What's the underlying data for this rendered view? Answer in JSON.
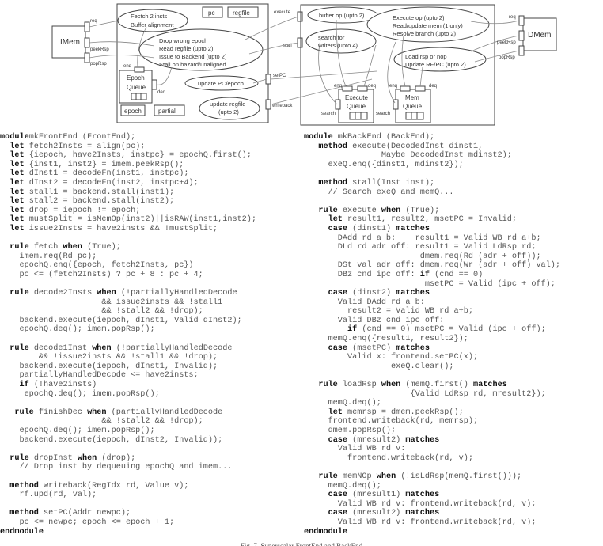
{
  "diagram": {
    "imem": {
      "label": "IMem",
      "ports": [
        "req",
        "peekRsp",
        "popRsp"
      ]
    },
    "dmem": {
      "label": "DMem",
      "ports": [
        "req",
        "peekRsp",
        "popRsp"
      ]
    },
    "frontend": {
      "state": [
        "pc",
        "regfile",
        "epoch",
        "partial"
      ],
      "clouds": {
        "fetch": [
          "Fectch 2 insts",
          "Buffer alignment"
        ],
        "decode": [
          "Drop wrong epoch",
          "Read regfile (upto 2)",
          "Issue to Backend  (upto 2)",
          "Stall on hazard/unaligned"
        ],
        "update_pc": [
          "update PC/epoch"
        ],
        "update_rf": [
          "update regfile",
          "(upto 2)"
        ]
      },
      "epoch_queue": {
        "label": [
          "Epoch",
          "Queue"
        ],
        "ports": [
          "enq",
          "deq"
        ]
      }
    },
    "interface_ports": [
      "execute",
      "stall",
      "setPC",
      "writeback"
    ],
    "backend": {
      "clouds": {
        "buffer": [
          "buffer op (upto 2)"
        ],
        "search": [
          "search for",
          "writers (upto 4)"
        ],
        "exec": [
          "Execute op (upto 2)",
          "Read/update mem (1 only)",
          "Resolve branch (upto 2)"
        ],
        "load": [
          "Load rsp or nop",
          "Update RF/PC (upto 2)"
        ]
      },
      "execute_queue": {
        "label": [
          "Execute",
          "Queue"
        ],
        "ports": [
          "enq",
          "deq",
          "search"
        ]
      },
      "mem_queue": {
        "label": [
          "Mem",
          "Queue"
        ],
        "ports": [
          "enq",
          "deq",
          "search"
        ]
      }
    }
  },
  "code_left": [
    [
      [
        "kw",
        "module"
      ],
      [
        "",
        "mkFrontEnd (FrontEnd);"
      ]
    ],
    [
      [
        "",
        "  "
      ],
      [
        "kw",
        "let"
      ],
      [
        "",
        " fetch2Insts = align(pc);"
      ]
    ],
    [
      [
        "",
        "  "
      ],
      [
        "kw",
        "let"
      ],
      [
        "",
        " {iepoch, have2Insts, instpc} = epochQ.first();"
      ]
    ],
    [
      [
        "",
        "  "
      ],
      [
        "kw",
        "let"
      ],
      [
        "",
        " {inst1, inst2} = imem.peekRsp();"
      ]
    ],
    [
      [
        "",
        "  "
      ],
      [
        "kw",
        "let"
      ],
      [
        "",
        " dInst1 = decodeFn(inst1, instpc);"
      ]
    ],
    [
      [
        "",
        "  "
      ],
      [
        "kw",
        "let"
      ],
      [
        "",
        " dInst2 = decodeFn(inst2, instpc+4);"
      ]
    ],
    [
      [
        "",
        "  "
      ],
      [
        "kw",
        "let"
      ],
      [
        "",
        " stall1 = backend.stall(inst1);"
      ]
    ],
    [
      [
        "",
        "  "
      ],
      [
        "kw",
        "let"
      ],
      [
        "",
        " stall2 = backend.stall(inst2);"
      ]
    ],
    [
      [
        "",
        "  "
      ],
      [
        "kw",
        "let"
      ],
      [
        "",
        " drop = iepoch != epoch;"
      ]
    ],
    [
      [
        "",
        "  "
      ],
      [
        "kw",
        "let"
      ],
      [
        "",
        " mustSplit = isMemOp(inst2)||isRAW(inst1,inst2);"
      ]
    ],
    [
      [
        "",
        "  "
      ],
      [
        "kw",
        "let"
      ],
      [
        "",
        " issue2Insts = have2insts && !mustSplit;"
      ]
    ],
    [
      [
        "",
        ""
      ]
    ],
    [
      [
        "",
        "  "
      ],
      [
        "kw",
        "rule"
      ],
      [
        "",
        " fetch "
      ],
      [
        "kw",
        "when"
      ],
      [
        "",
        " (True);"
      ]
    ],
    [
      [
        "",
        "    imem.req(Rd pc);"
      ]
    ],
    [
      [
        "",
        "    epochQ.enq({epoch, fetch2Insts, pc})"
      ]
    ],
    [
      [
        "",
        "    pc <= (fetch2Insts) ? pc + 8 : pc + 4;"
      ]
    ],
    [
      [
        "",
        ""
      ]
    ],
    [
      [
        "",
        "  "
      ],
      [
        "kw",
        "rule"
      ],
      [
        "",
        " decode2Insts "
      ],
      [
        "kw",
        "when"
      ],
      [
        "",
        " (!partiallyHandledDecode"
      ]
    ],
    [
      [
        "",
        "                     && issue2insts && !stall1"
      ]
    ],
    [
      [
        "",
        "                     && !stall2 && !drop);"
      ]
    ],
    [
      [
        "",
        "    backend.execute(iepoch, dInst1, Valid dInst2);"
      ]
    ],
    [
      [
        "",
        "    epochQ.deq(); imem.popRsp();"
      ]
    ],
    [
      [
        "",
        ""
      ]
    ],
    [
      [
        "",
        "  "
      ],
      [
        "kw",
        "rule"
      ],
      [
        "",
        " decode1Inst "
      ],
      [
        "kw",
        "when"
      ],
      [
        "",
        " (!partiallyHandledDecode"
      ]
    ],
    [
      [
        "",
        "        && !issue2insts && !stall1 && !drop);"
      ]
    ],
    [
      [
        "",
        "    backend.execute(iepoch, dInst1, Invalid);"
      ]
    ],
    [
      [
        "",
        "    partiallyHandledDecode <= have2insts;"
      ]
    ],
    [
      [
        "",
        "    "
      ],
      [
        "kw",
        "if"
      ],
      [
        "",
        " (!have2insts)"
      ]
    ],
    [
      [
        "",
        "     epochQ.deq(); imem.popRsp();"
      ]
    ],
    [
      [
        "",
        ""
      ]
    ],
    [
      [
        "",
        "   "
      ],
      [
        "kw",
        "rule"
      ],
      [
        "",
        " finishDec "
      ],
      [
        "kw",
        "when"
      ],
      [
        "",
        " (partiallyHandledDecode"
      ]
    ],
    [
      [
        "",
        "                     && !stall2 && !drop);"
      ]
    ],
    [
      [
        "",
        "    epochQ.deq(); imem.popRsp();"
      ]
    ],
    [
      [
        "",
        "    backend.execute(iepoch, dInst2, Invalid));"
      ]
    ],
    [
      [
        "",
        ""
      ]
    ],
    [
      [
        "",
        "  "
      ],
      [
        "kw",
        "rule"
      ],
      [
        "",
        " dropInst "
      ],
      [
        "kw",
        "when"
      ],
      [
        "",
        " (drop);"
      ]
    ],
    [
      [
        "",
        "    // Drop inst by dequeuing epochQ and imem..."
      ]
    ],
    [
      [
        "",
        ""
      ]
    ],
    [
      [
        "",
        "  "
      ],
      [
        "kw",
        "method"
      ],
      [
        "",
        " writeback(RegIdx rd, Value v);"
      ]
    ],
    [
      [
        "",
        "    rf.upd(rd, val);"
      ]
    ],
    [
      [
        "",
        ""
      ]
    ],
    [
      [
        "",
        "  "
      ],
      [
        "kw",
        "method"
      ],
      [
        "",
        " setPC(Addr newpc);"
      ]
    ],
    [
      [
        "",
        "    pc <= newpc; epoch <= epoch + 1;"
      ]
    ],
    [
      [
        "kw",
        "endmodule"
      ]
    ]
  ],
  "code_right": [
    [
      [
        "kw",
        "module"
      ],
      [
        "",
        " mkBackEnd (BackEnd);"
      ]
    ],
    [
      [
        "",
        "   "
      ],
      [
        "kw",
        "method"
      ],
      [
        "",
        " execute(DecodedInst dinst1,"
      ]
    ],
    [
      [
        "",
        "                Maybe DecodedInst mdinst2);"
      ]
    ],
    [
      [
        "",
        "     exeQ.enq({dinst1, mdinst2});"
      ]
    ],
    [
      [
        "",
        ""
      ]
    ],
    [
      [
        "",
        "   "
      ],
      [
        "kw",
        "method"
      ],
      [
        "",
        " stall(Inst inst);"
      ]
    ],
    [
      [
        "",
        "     // Search exeQ and memQ..."
      ]
    ],
    [
      [
        "",
        ""
      ]
    ],
    [
      [
        "",
        "   "
      ],
      [
        "kw",
        "rule"
      ],
      [
        "",
        " execute "
      ],
      [
        "kw",
        "when"
      ],
      [
        "",
        " (True);"
      ]
    ],
    [
      [
        "",
        "     "
      ],
      [
        "kw",
        "let"
      ],
      [
        "",
        " result1, result2, msetPC = Invalid;"
      ]
    ],
    [
      [
        "",
        "     "
      ],
      [
        "kw",
        "case"
      ],
      [
        "",
        " (dinst1) "
      ],
      [
        "kw",
        "matches"
      ]
    ],
    [
      [
        "",
        "       DAdd rd a b:    result1 = Valid WB rd a+b;"
      ]
    ],
    [
      [
        "",
        "       DLd rd adr off: result1 = Valid LdRsp rd;"
      ]
    ],
    [
      [
        "",
        "                        dmem.req(Rd (adr + off));"
      ]
    ],
    [
      [
        "",
        "       DSt val adr off: dmem.req(Wr (adr + off) val);"
      ]
    ],
    [
      [
        "",
        "       DBz cnd ipc off: "
      ],
      [
        "kw",
        "if"
      ],
      [
        "",
        " (cnd == 0)"
      ]
    ],
    [
      [
        "",
        "                         msetPC = Valid (ipc + off);"
      ]
    ],
    [
      [
        "",
        "     "
      ],
      [
        "kw",
        "case"
      ],
      [
        "",
        " (dinst2) "
      ],
      [
        "kw",
        "matches"
      ]
    ],
    [
      [
        "",
        "       Valid DAdd rd a b:"
      ]
    ],
    [
      [
        "",
        "         result2 = Valid WB rd a+b;"
      ]
    ],
    [
      [
        "",
        "       Valid DBz cnd ipc off:"
      ]
    ],
    [
      [
        "",
        "         "
      ],
      [
        "kw",
        "if"
      ],
      [
        "",
        " (cnd == 0) msetPC = Valid (ipc + off);"
      ]
    ],
    [
      [
        "",
        "     memQ.enq({result1, result2});"
      ]
    ],
    [
      [
        "",
        "     "
      ],
      [
        "kw",
        "case"
      ],
      [
        "",
        " (msetPC) "
      ],
      [
        "kw",
        "matches"
      ]
    ],
    [
      [
        "",
        "         Valid x: frontend.setPC(x);"
      ]
    ],
    [
      [
        "",
        "                  exeQ.clear();"
      ]
    ],
    [
      [
        "",
        ""
      ]
    ],
    [
      [
        "",
        "   "
      ],
      [
        "kw",
        "rule"
      ],
      [
        "",
        " loadRsp "
      ],
      [
        "kw",
        "when"
      ],
      [
        "",
        " (memQ.first() "
      ],
      [
        "kw",
        "matches"
      ]
    ],
    [
      [
        "",
        "                      {Valid LdRsp rd, mresult2});"
      ]
    ],
    [
      [
        "",
        "     memQ.deq();"
      ]
    ],
    [
      [
        "",
        "     "
      ],
      [
        "kw",
        "let"
      ],
      [
        "",
        " memrsp = dmem.peekRsp();"
      ]
    ],
    [
      [
        "",
        "     frontend.writeback(rd, memrsp);"
      ]
    ],
    [
      [
        "",
        "     dmem.popRsp();"
      ]
    ],
    [
      [
        "",
        "     "
      ],
      [
        "kw",
        "case"
      ],
      [
        "",
        " (mresult2) "
      ],
      [
        "kw",
        "matches"
      ]
    ],
    [
      [
        "",
        "       Valid WB rd v:"
      ]
    ],
    [
      [
        "",
        "         frontend.writeback(rd, v);"
      ]
    ],
    [
      [
        "",
        ""
      ]
    ],
    [
      [
        "",
        "   "
      ],
      [
        "kw",
        "rule"
      ],
      [
        "",
        " memNOp "
      ],
      [
        "kw",
        "when"
      ],
      [
        "",
        " (!isLdRsp(memQ.first()));"
      ]
    ],
    [
      [
        "",
        "     memQ.deq();"
      ]
    ],
    [
      [
        "",
        "     "
      ],
      [
        "kw",
        "case"
      ],
      [
        "",
        " (mresult1) "
      ],
      [
        "kw",
        "matches"
      ]
    ],
    [
      [
        "",
        "       Valid WB rd v: frontend.writeback(rd, v);"
      ]
    ],
    [
      [
        "",
        "     "
      ],
      [
        "kw",
        "case"
      ],
      [
        "",
        " (mresult2) "
      ],
      [
        "kw",
        "matches"
      ]
    ],
    [
      [
        "",
        "       Valid WB rd v: frontend.writeback(rd, v);"
      ]
    ],
    [
      [
        "kw",
        "endmodule"
      ]
    ]
  ],
  "caption": "Fig. 7.  Superscalar FrontEnd and BackEnd"
}
